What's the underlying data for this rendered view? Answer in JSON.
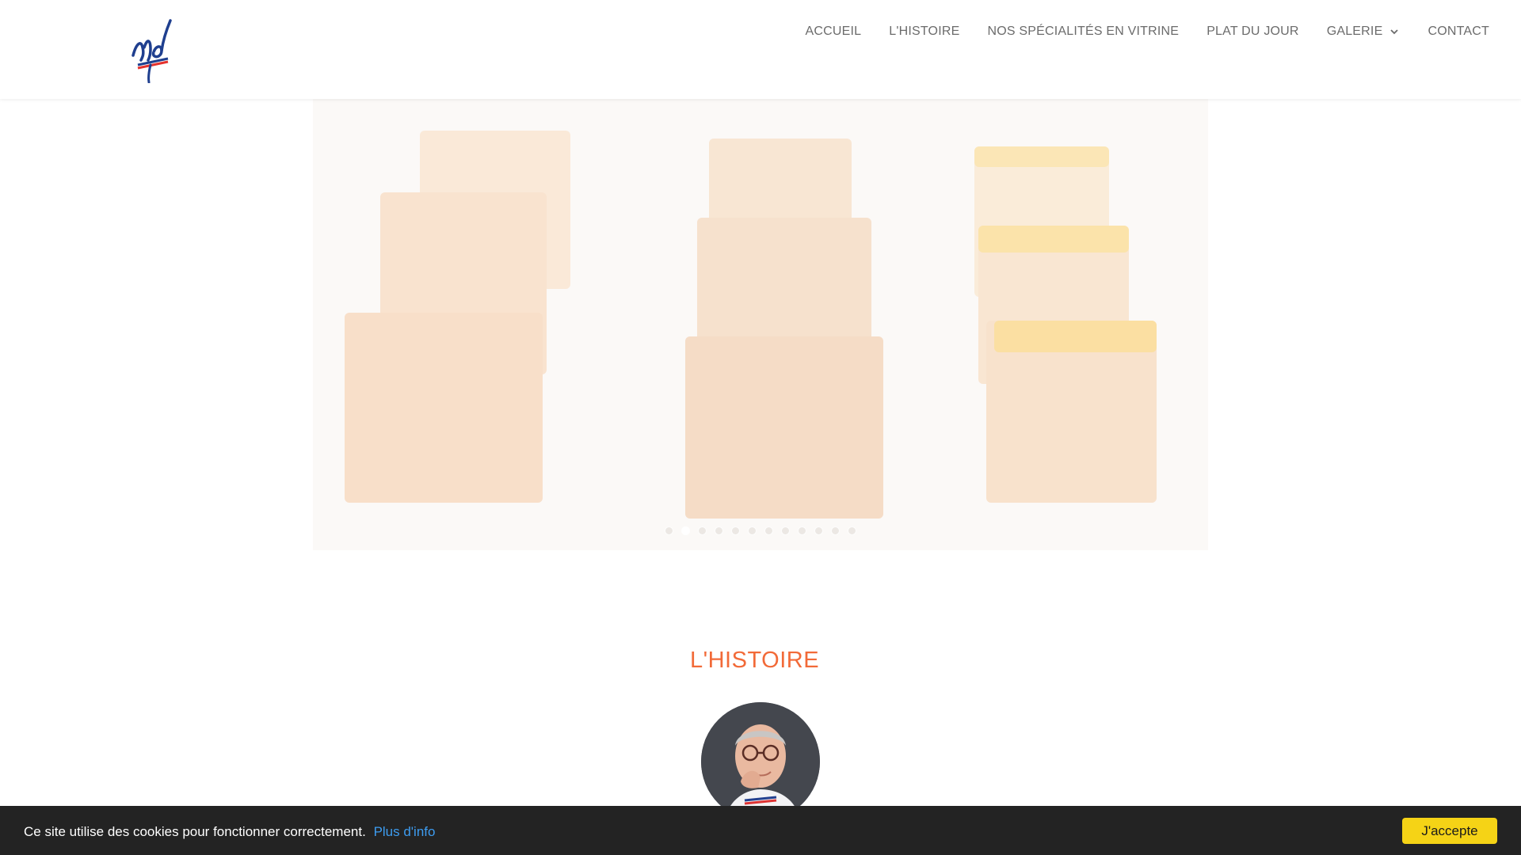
{
  "nav": {
    "items": [
      {
        "label": "ACCUEIL"
      },
      {
        "label": "L'HISTOIRE"
      },
      {
        "label": "NOS SPÉCIALITÉS EN VITRINE"
      },
      {
        "label": "PLAT DU JOUR"
      },
      {
        "label": "GALERIE",
        "icon": "chevron-down-icon"
      },
      {
        "label": "CONTACT"
      }
    ]
  },
  "hero": {
    "slide_count": 12,
    "active_slide": 1
  },
  "histoire": {
    "title": "L'HISTOIRE"
  },
  "cookie": {
    "message": "Ce site utilise des cookies pour fonctionner correctement.",
    "link_label": "Plus d'info",
    "accept_label": "J'accepte"
  },
  "colors": {
    "accent": "#f26a38",
    "cookie_bg": "#232323",
    "accept_button": "#f5d316",
    "link": "#3d9cf0",
    "nav_text": "#6b6b6b"
  }
}
